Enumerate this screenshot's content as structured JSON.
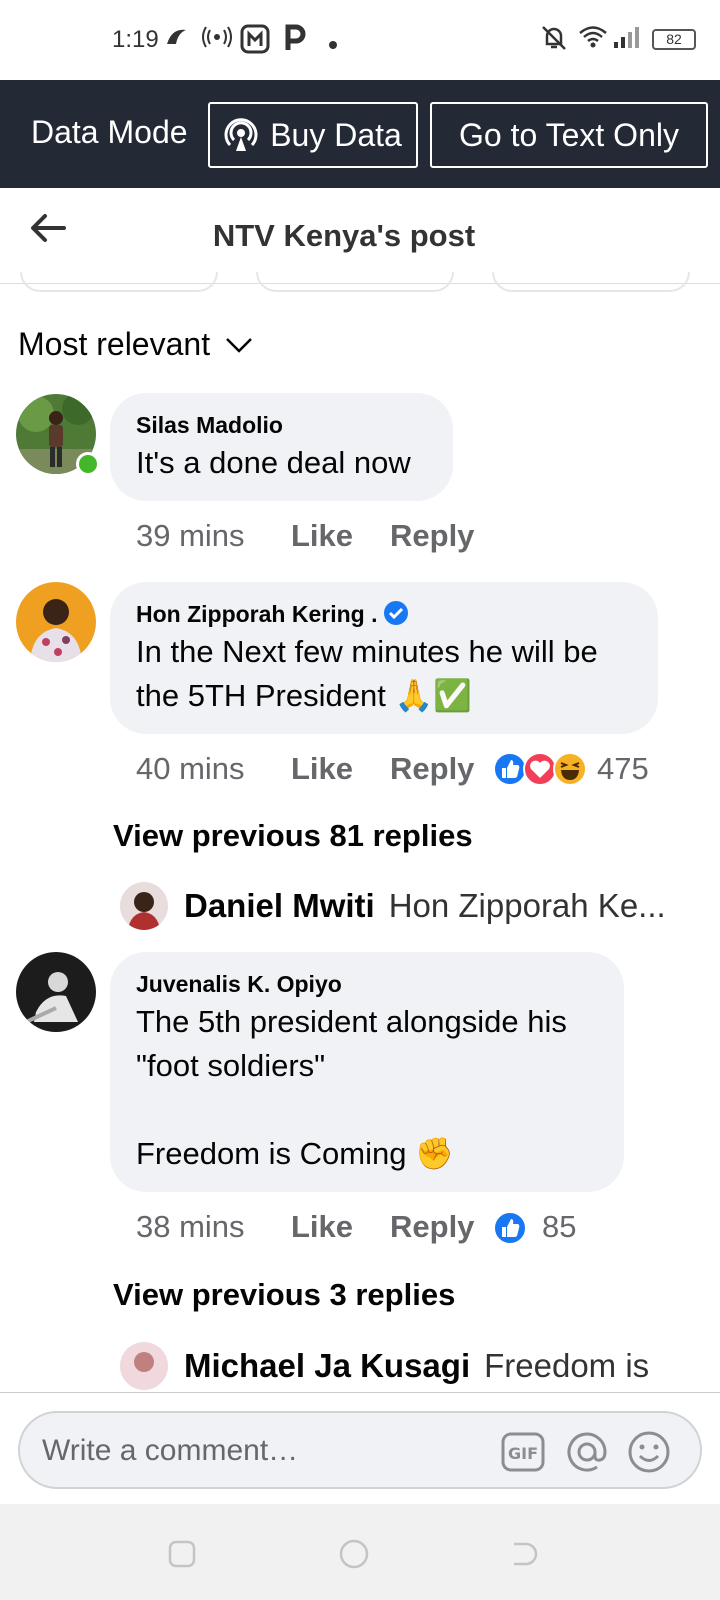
{
  "status_bar": {
    "time": "1:19",
    "battery": "82"
  },
  "data_bar": {
    "label": "Data Mode",
    "buy_data": "Buy Data",
    "text_only": "Go to Text Only"
  },
  "header": {
    "title": "NTV Kenya's post"
  },
  "sort": {
    "label": "Most relevant"
  },
  "comments": [
    {
      "author": "Silas Madolio",
      "text": "It's a done deal now",
      "time": "39 mins",
      "like": "Like",
      "reply": "Reply"
    },
    {
      "author": "Hon Zipporah Kering .",
      "text": "In the Next few minutes he will be the 5TH President 🙏✅",
      "time": "40 mins",
      "like": "Like",
      "reply": "Reply",
      "reactions": "475",
      "view_previous": "View previous 81 replies",
      "reply_preview": {
        "name": "Daniel Mwiti",
        "snippet": "Hon Zipporah Ke..."
      }
    },
    {
      "author": "Juvenalis K. Opiyo",
      "text": "The 5th president alongside his \"foot soldiers\"\n\nFreedom is Coming ✊",
      "time": "38 mins",
      "like": "Like",
      "reply": "Reply",
      "reactions": "85",
      "view_previous": "View previous 3 replies",
      "reply_preview": {
        "name": "Michael Ja Kusagi",
        "snippet": "Freedom is"
      }
    }
  ],
  "composer": {
    "placeholder": "Write a comment…",
    "gif": "GIF"
  },
  "colors": {
    "data_bar": "#242a35",
    "bubble": "#f0f2f5",
    "like_blue": "#1877f2",
    "love_red": "#f33e58",
    "online_green": "#42b72a"
  }
}
